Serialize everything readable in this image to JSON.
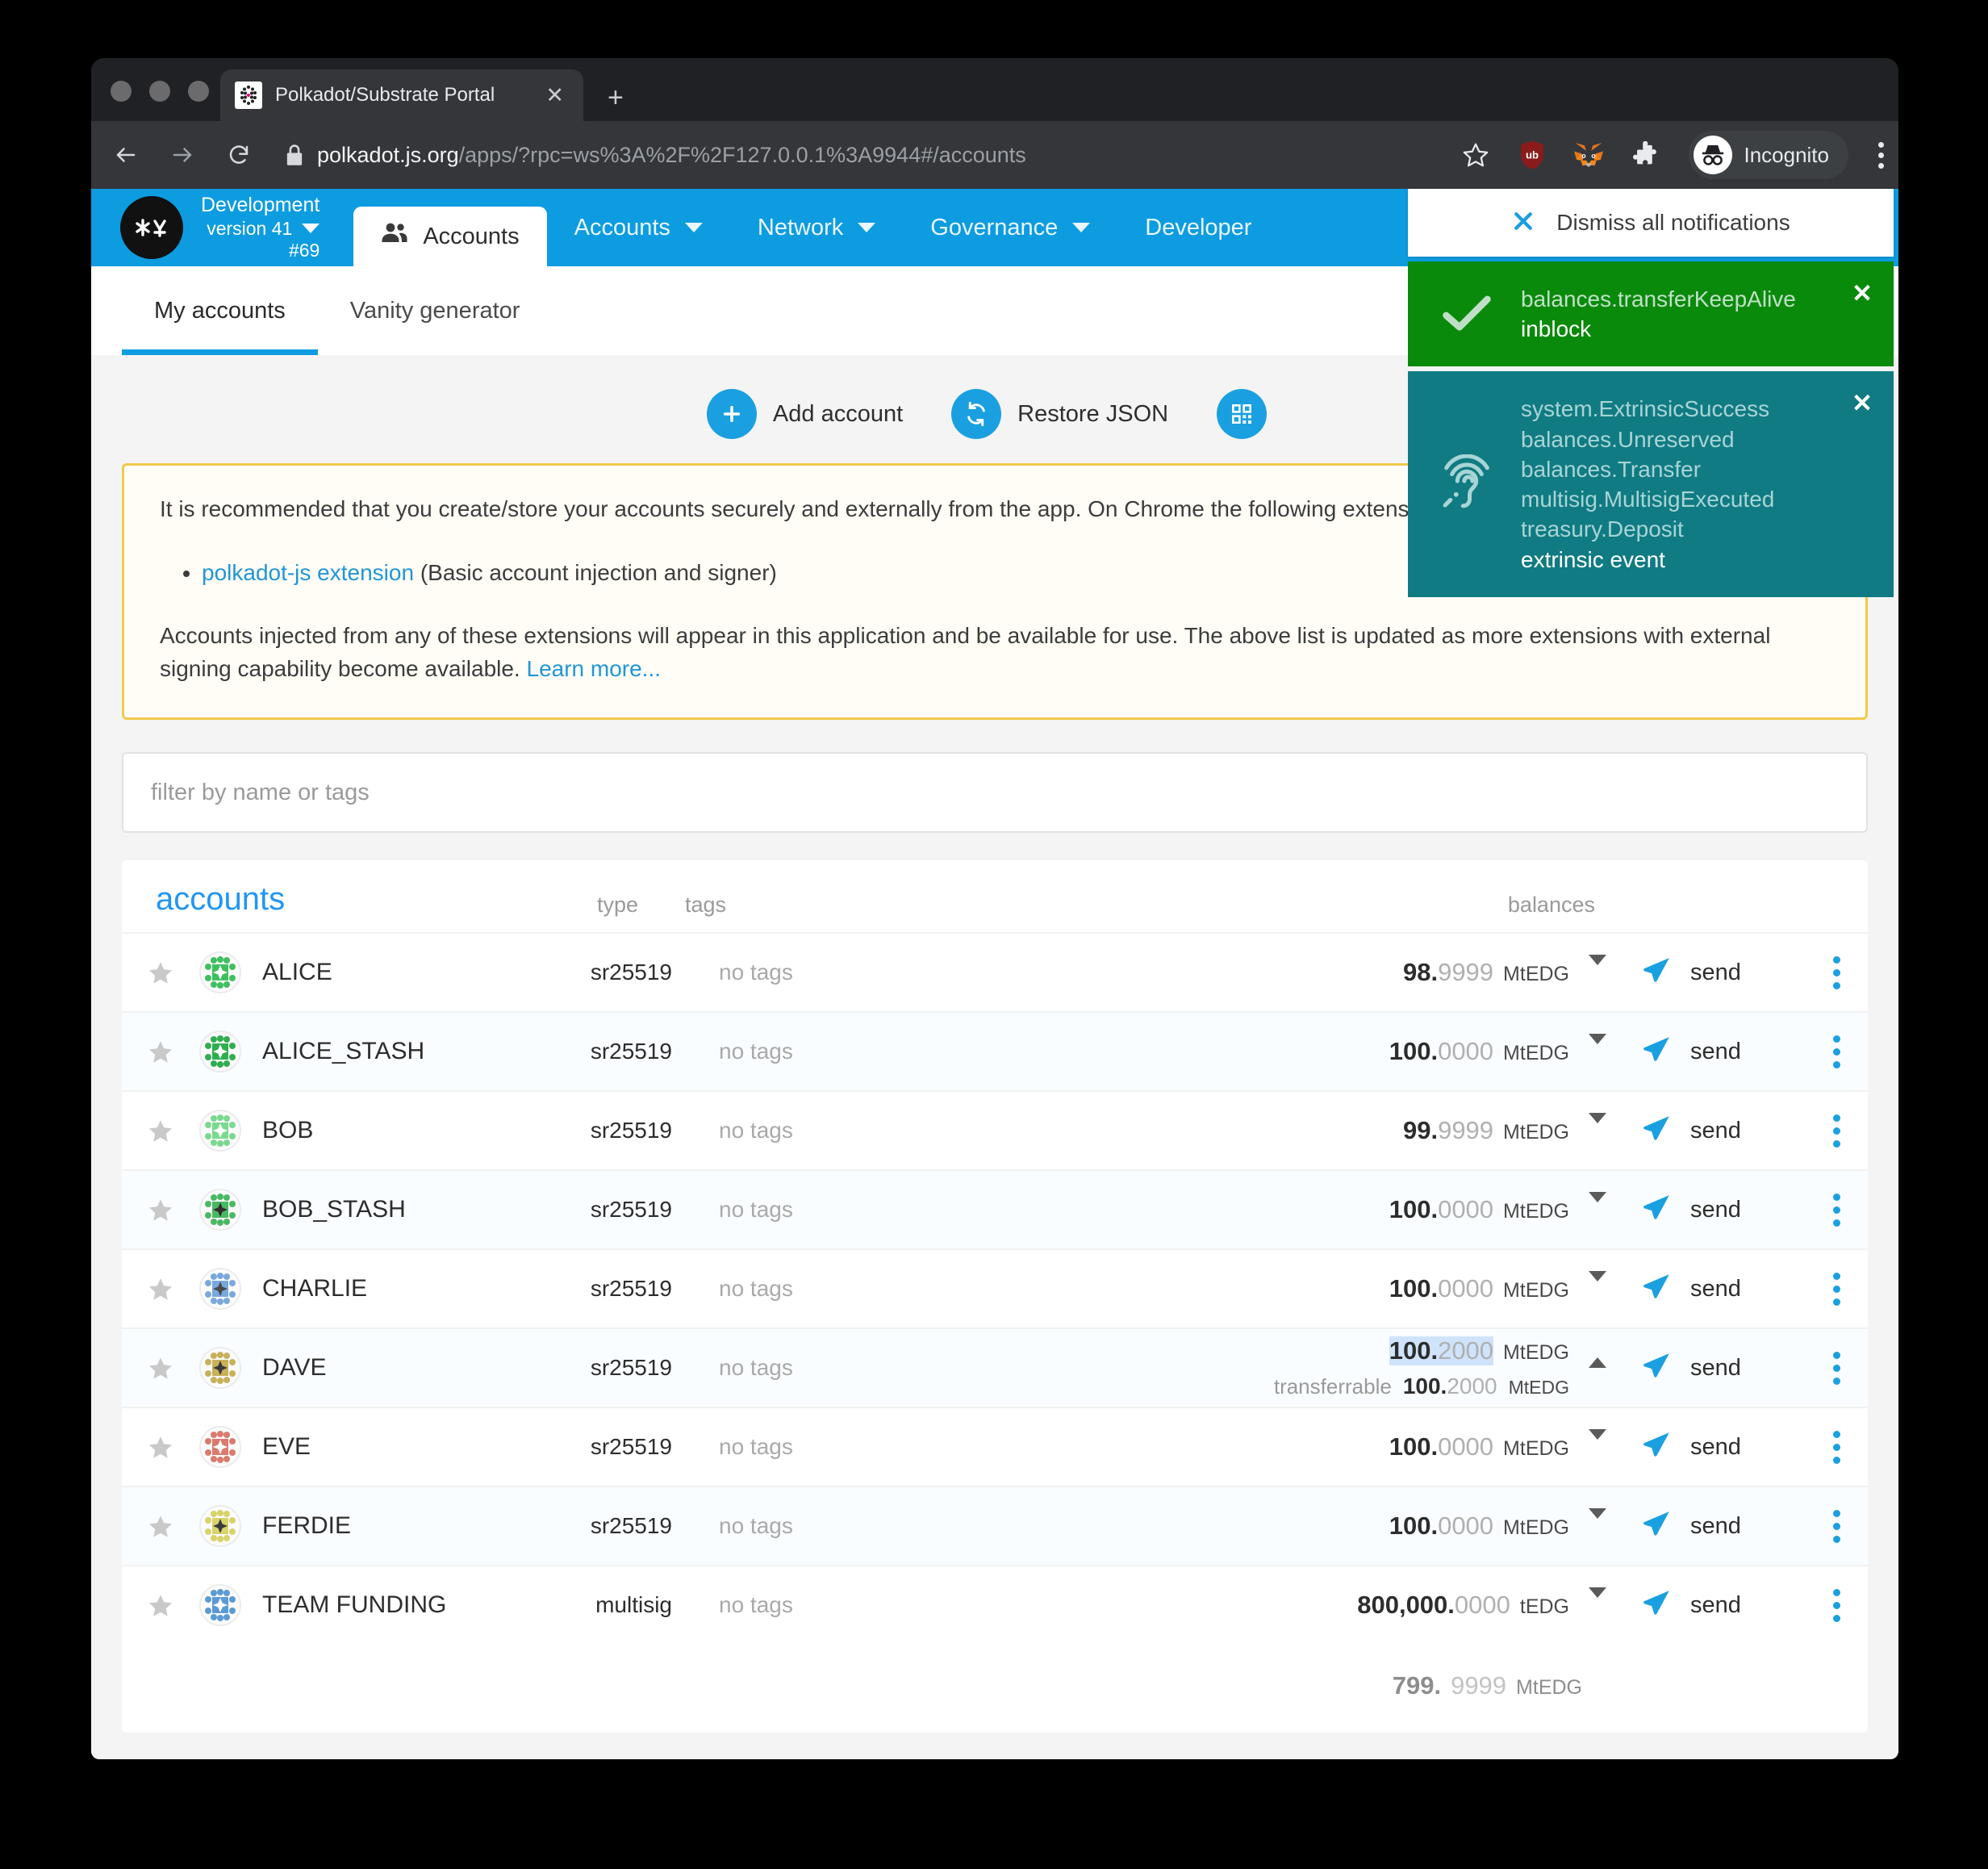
{
  "browser": {
    "tab_title": "Polkadot/Substrate Portal",
    "tab_close_icon": "close-icon",
    "new_tab_icon": "plus-icon",
    "back_icon": "back-arrow-icon",
    "forward_icon": "forward-arrow-icon",
    "reload_icon": "reload-icon",
    "lock_icon": "lock-icon",
    "url_domain": "polkadot.js.org",
    "url_path": "/apps/?rpc=ws%3A%2F%2F127.0.0.1%3A9944#/accounts",
    "bookmark_icon": "star-icon",
    "ublock_icon": "ublock-origin-icon",
    "metamask_icon": "metamask-fox-icon",
    "extensions_icon": "puzzle-piece-icon",
    "incognito_label": "Incognito",
    "incognito_icon": "incognito-hat-icon",
    "menu_icon": "kebab-menu-icon"
  },
  "appbar": {
    "chain_name": "Development",
    "chain_version": "version 41",
    "chain_block": "#69",
    "chain_caret_icon": "chevron-down-icon",
    "active_tab": "Accounts",
    "active_tab_icon": "people-icon",
    "nav": [
      {
        "label": "Accounts",
        "caret_icon": "chevron-down-icon"
      },
      {
        "label": "Network",
        "caret_icon": "chevron-down-icon"
      },
      {
        "label": "Governance",
        "caret_icon": "chevron-down-icon"
      },
      {
        "label": "Developer",
        "caret_icon": "chevron-down-icon"
      }
    ]
  },
  "subtabs": [
    {
      "label": "My accounts",
      "active": true
    },
    {
      "label": "Vanity generator",
      "active": false
    }
  ],
  "actions": [
    {
      "label": "Add account",
      "icon": "plus-circle-icon"
    },
    {
      "label": "Restore JSON",
      "icon": "sync-circle-icon"
    },
    {
      "label": "",
      "icon": "qr-code-icon"
    }
  ],
  "banner": {
    "paragraph1": "It is recommended that you create/store your accounts securely and externally from the app. On Chrome the following extensions are available:",
    "bullet_link": "polkadot-js extension",
    "bullet_rest": " (Basic account injection and signer)",
    "paragraph2": "Accounts injected from any of these extensions will appear in this application and be available for use. The above list is updated as more extensions with external signing capability become available. ",
    "learn_more": "Learn more..."
  },
  "filter": {
    "placeholder": "filter by name or tags",
    "value": ""
  },
  "table": {
    "headers": {
      "accounts": "accounts",
      "type": "type",
      "tags": "tags",
      "balances": "balances"
    },
    "star_icon": "star-favorite-icon",
    "send_icon": "paper-plane-icon",
    "send_label": "send",
    "more_icon": "kebab-menu-icon",
    "rows": [
      {
        "name": "ALICE",
        "type": "sr25519",
        "tags": "no tags",
        "bal_int": "98.",
        "bal_dec": "9999",
        "unit": "MtEDG",
        "expanded": false,
        "selected": false,
        "ident": "alice"
      },
      {
        "name": "ALICE_STASH",
        "type": "sr25519",
        "tags": "no tags",
        "bal_int": "100.",
        "bal_dec": "0000",
        "unit": "MtEDG",
        "expanded": false,
        "selected": false,
        "ident": "alice_stash"
      },
      {
        "name": "BOB",
        "type": "sr25519",
        "tags": "no tags",
        "bal_int": "99.",
        "bal_dec": "9999",
        "unit": "MtEDG",
        "expanded": false,
        "selected": false,
        "ident": "bob"
      },
      {
        "name": "BOB_STASH",
        "type": "sr25519",
        "tags": "no tags",
        "bal_int": "100.",
        "bal_dec": "0000",
        "unit": "MtEDG",
        "expanded": false,
        "selected": false,
        "ident": "bob_stash"
      },
      {
        "name": "CHARLIE",
        "type": "sr25519",
        "tags": "no tags",
        "bal_int": "100.",
        "bal_dec": "0000",
        "unit": "MtEDG",
        "expanded": false,
        "selected": false,
        "ident": "charlie"
      },
      {
        "name": "DAVE",
        "type": "sr25519",
        "tags": "no tags",
        "bal_int": "100.",
        "bal_dec": "2000",
        "unit": "MtEDG",
        "expanded": true,
        "selected": true,
        "ident": "dave",
        "detail_label": "transferrable",
        "detail_int": "100.",
        "detail_dec": "2000",
        "detail_unit": "MtEDG"
      },
      {
        "name": "EVE",
        "type": "sr25519",
        "tags": "no tags",
        "bal_int": "100.",
        "bal_dec": "0000",
        "unit": "MtEDG",
        "expanded": false,
        "selected": false,
        "ident": "eve"
      },
      {
        "name": "FERDIE",
        "type": "sr25519",
        "tags": "no tags",
        "bal_int": "100.",
        "bal_dec": "0000",
        "unit": "MtEDG",
        "expanded": false,
        "selected": false,
        "ident": "ferdie"
      },
      {
        "name": "TEAM FUNDING",
        "type": "multisig",
        "tags": "no tags",
        "bal_int": "800,000.",
        "bal_dec": "0000",
        "unit": "tEDG",
        "expanded": false,
        "selected": false,
        "ident": "team"
      }
    ],
    "total_int": "799.",
    "total_dec": "9999",
    "total_unit": "MtEDG"
  },
  "notifications": {
    "dismiss_all_label": "Dismiss all notifications",
    "dismiss_all_icon": "close-icon",
    "items": [
      {
        "variant": "green",
        "icon": "check-mark-icon",
        "close_icon": "close-icon",
        "lines": [
          "balances.transferKeepAlive"
        ],
        "strong": "inblock"
      },
      {
        "variant": "teal",
        "icon": "broadcast-ear-icon",
        "close_icon": "close-icon",
        "lines": [
          "system.ExtrinsicSuccess",
          "balances.Unreserved",
          "balances.Transfer",
          "multisig.MultisigExecuted",
          "treasury.Deposit"
        ],
        "strong": "extrinsic event"
      }
    ]
  },
  "colors": {
    "brand_blue": "#0d9ce0",
    "accent_blue": "#1aa0e0",
    "success_green": "#0a8a0a",
    "info_teal": "#107b82",
    "warn_border": "#f2c94c"
  }
}
